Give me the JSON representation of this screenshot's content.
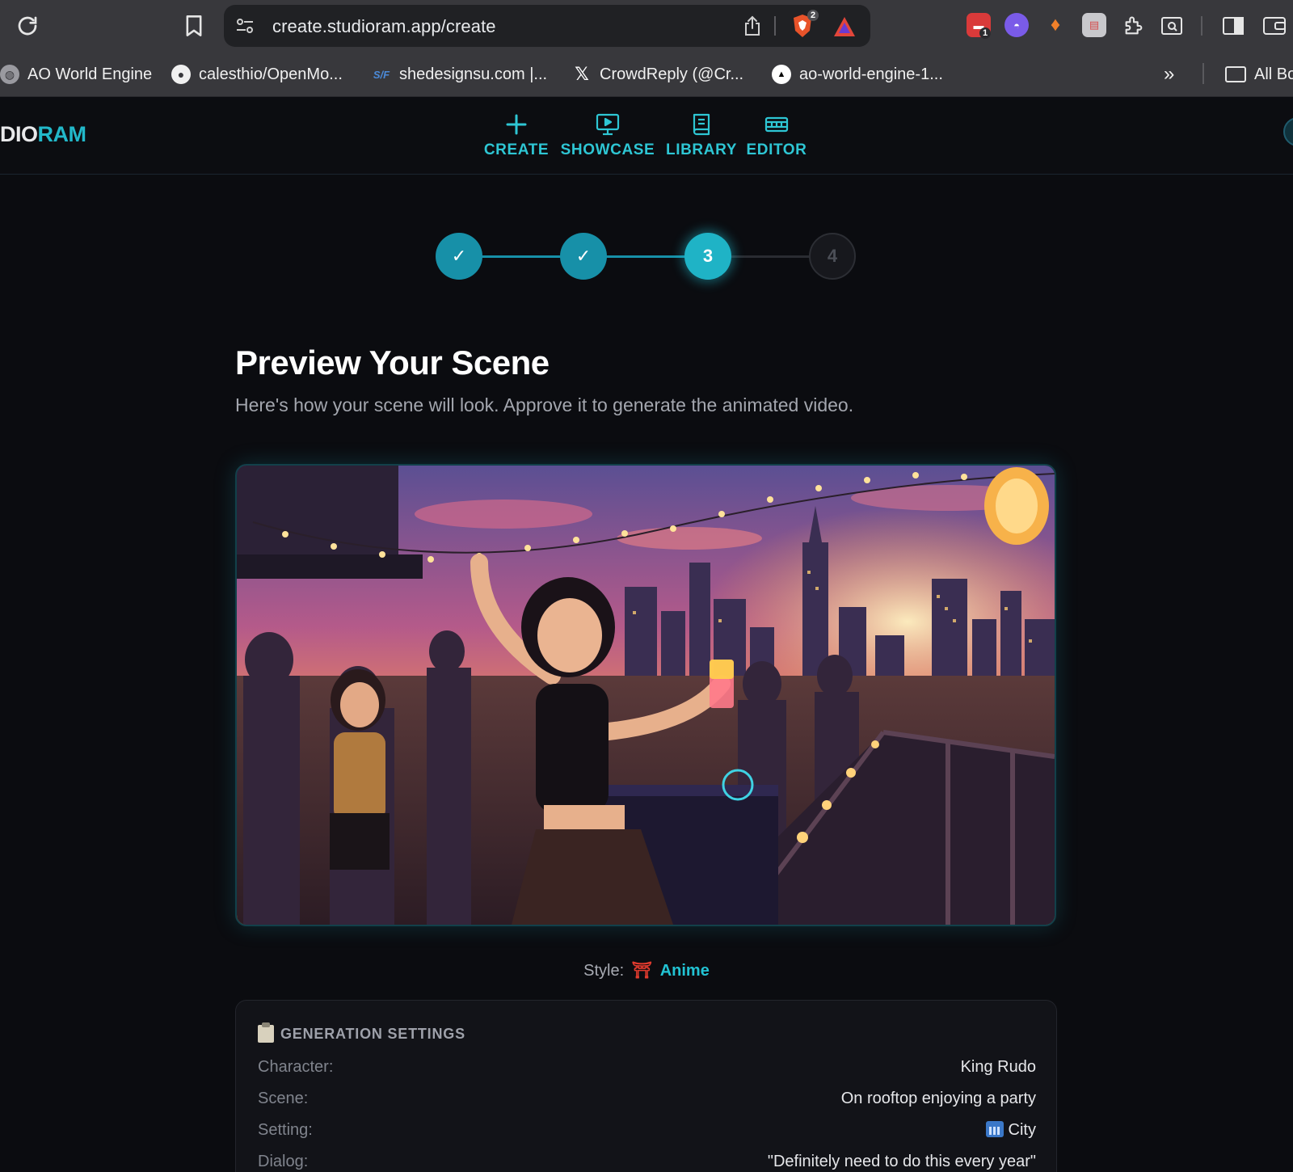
{
  "browser": {
    "url": "create.studioram.app/create",
    "shield_badge": "2",
    "ext_badge": "1",
    "bookmarks": [
      {
        "label": "AO World Engine"
      },
      {
        "label": "calesthio/OpenMo..."
      },
      {
        "label": "shedesignsu.com |..."
      },
      {
        "label": "CrowdReply (@Cr..."
      },
      {
        "label": "ao-world-engine-1..."
      }
    ],
    "more_bookmarks": "»",
    "all_bookmarks": "All Bo"
  },
  "app": {
    "logo_part1": "DIO",
    "logo_part2": "RAM",
    "nav": [
      {
        "label": "CREATE",
        "icon": "plus-icon"
      },
      {
        "label": "SHOWCASE",
        "icon": "monitor-play-icon"
      },
      {
        "label": "LIBRARY",
        "icon": "book-icon"
      },
      {
        "label": "EDITOR",
        "icon": "film-strip-icon"
      }
    ]
  },
  "stepper": {
    "current": 3,
    "steps": [
      "✓",
      "✓",
      "3",
      "4"
    ]
  },
  "main": {
    "title": "Preview Your Scene",
    "subtitle": "Here's how your scene will look. Approve it to generate the animated video.",
    "style_label": "Style:",
    "style_icon": "⛩",
    "style_value": "Anime"
  },
  "settings": {
    "heading": "GENERATION SETTINGS",
    "rows": [
      {
        "key": "Character:",
        "value": "King Rudo"
      },
      {
        "key": "Scene:",
        "value": "On rooftop enjoying a party"
      },
      {
        "key": "Setting:",
        "value": "City"
      },
      {
        "key": "Dialog:",
        "value": "\"Definitely need to do this every year\""
      }
    ]
  },
  "colors": {
    "accent": "#22b8c9",
    "background": "#0b0c10",
    "chrome": "#38383c"
  }
}
